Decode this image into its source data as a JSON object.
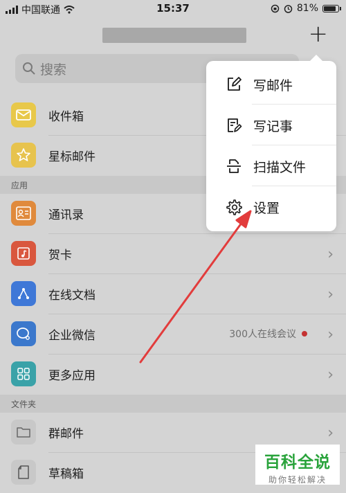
{
  "status_bar": {
    "carrier": "中国联通",
    "time": "15:37",
    "battery": "81%"
  },
  "header": {
    "add_icon": "plus-icon"
  },
  "search": {
    "placeholder": "搜索"
  },
  "mail_items": [
    {
      "label": "收件箱",
      "icon": "inbox-icon",
      "color": "#e8c84a"
    },
    {
      "label": "星标邮件",
      "icon": "star-icon",
      "color": "#e7c34e"
    }
  ],
  "sections": {
    "apps": "应用",
    "folders": "文件夹"
  },
  "app_items": [
    {
      "label": "通讯录",
      "icon": "contacts-icon",
      "color": "#e08a3c"
    },
    {
      "label": "贺卡",
      "icon": "card-icon",
      "color": "#d9573e"
    },
    {
      "label": "在线文档",
      "icon": "document-icon",
      "color": "#3f78d7"
    },
    {
      "label": "企业微信",
      "icon": "wework-icon",
      "color": "#3b78cc",
      "extra": "300人在线会议"
    },
    {
      "label": "更多应用",
      "icon": "grid-icon",
      "color": "#3aa2a8"
    }
  ],
  "folder_items": [
    {
      "label": "群邮件",
      "icon": "folder-icon"
    },
    {
      "label": "草稿箱",
      "icon": "draft-icon"
    }
  ],
  "menu": {
    "items": [
      {
        "label": "写邮件",
        "icon": "compose-icon"
      },
      {
        "label": "写记事",
        "icon": "note-icon"
      },
      {
        "label": "扫描文件",
        "icon": "scan-icon"
      },
      {
        "label": "设置",
        "icon": "gear-icon"
      }
    ]
  },
  "watermark": {
    "title": "百科全说",
    "subtitle": "助你轻松解决"
  },
  "colors": {
    "accent_arrow": "#e23c3c",
    "watermark_green": "#29a33b",
    "badge_red": "#c43232"
  }
}
